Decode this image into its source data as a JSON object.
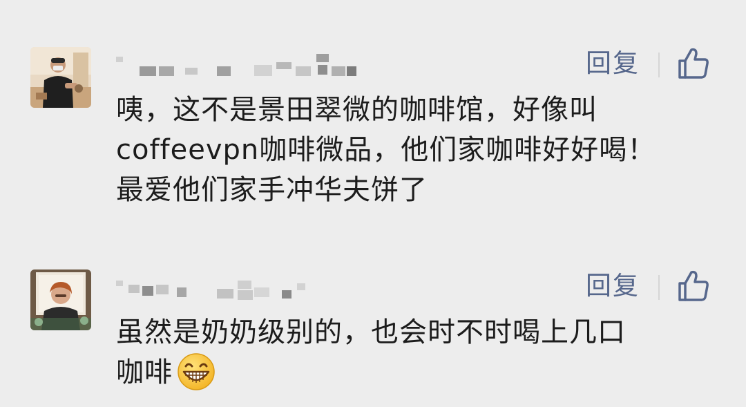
{
  "comments": [
    {
      "reply_label": "回复",
      "text_lines": [
        "咦，这不是景田翠微的咖啡馆，好像叫",
        "coffeevpn咖啡微品，他们家咖啡好好喝！",
        "最爱他们家手冲华夫饼了"
      ]
    },
    {
      "reply_label": "回复",
      "text_lines": [
        "虽然是奶奶级别的，也会时不时喝上几口",
        "咖啡"
      ],
      "trailing_emoji": "grinning-face-emoji"
    }
  ],
  "colors": {
    "background": "#ededed",
    "text": "#1c1c1c",
    "reply_link": "#56678c",
    "like_icon": "#56678c",
    "censor_pixels": "#b3b3b3"
  },
  "icons": {
    "like": "thumbs-up-icon",
    "emoji": "grinning-face-emoji"
  }
}
